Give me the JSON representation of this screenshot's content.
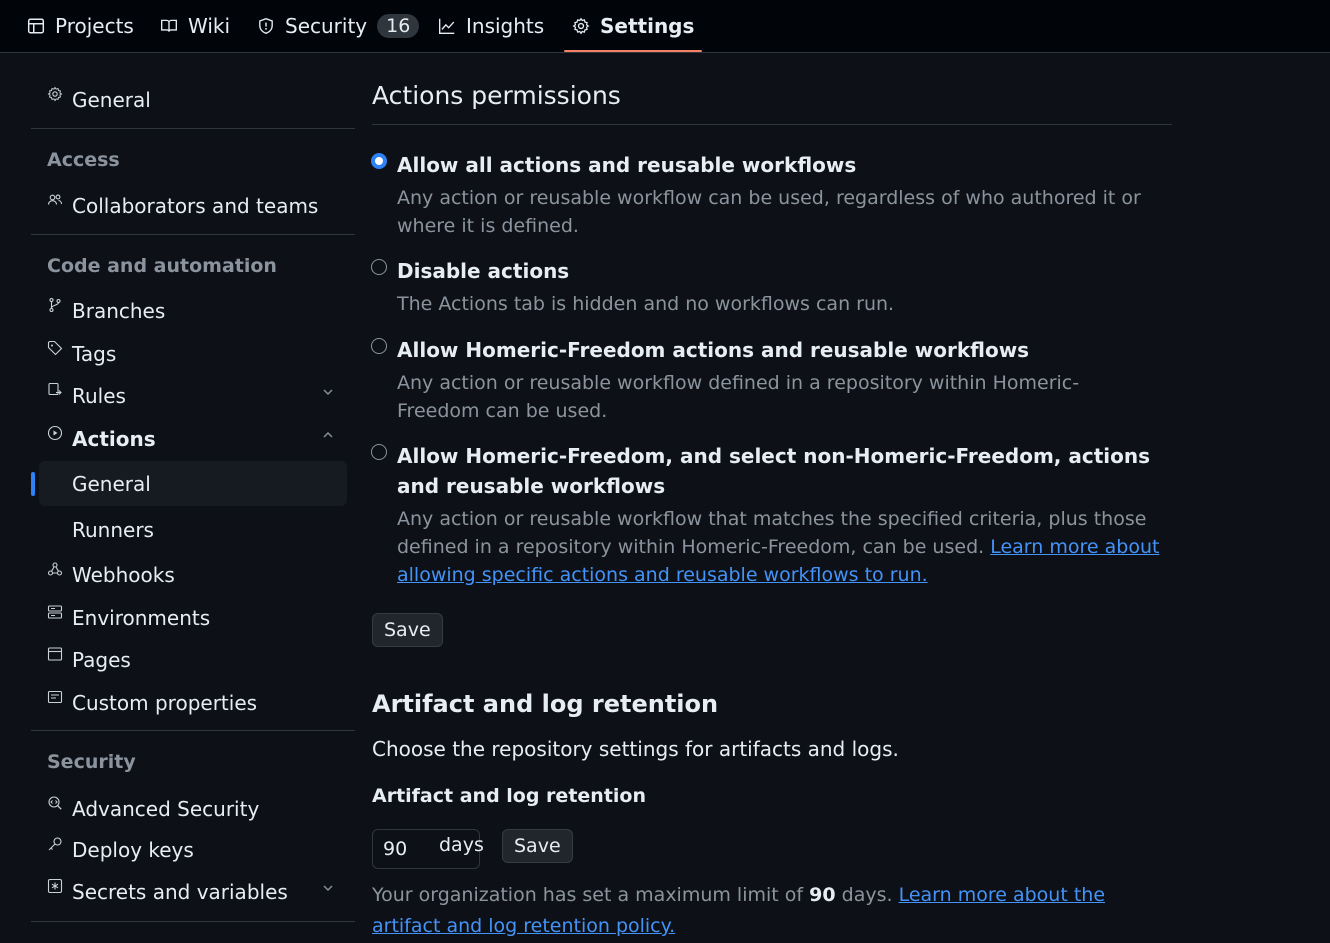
{
  "topnav": {
    "tabs": [
      {
        "label": "Projects",
        "icon": "table-icon"
      },
      {
        "label": "Wiki",
        "icon": "book-icon"
      },
      {
        "label": "Security",
        "icon": "shield-icon",
        "count": "16"
      },
      {
        "label": "Insights",
        "icon": "graph-icon"
      },
      {
        "label": "Settings",
        "icon": "gear-icon",
        "active": true
      }
    ]
  },
  "sidebar": {
    "general": "General",
    "access_heading": "Access",
    "collaborators": "Collaborators and teams",
    "code_heading": "Code and automation",
    "branches": "Branches",
    "tags": "Tags",
    "rules": "Rules",
    "actions": "Actions",
    "actions_general": "General",
    "actions_runners": "Runners",
    "webhooks": "Webhooks",
    "environments": "Environments",
    "pages": "Pages",
    "custom_properties": "Custom properties",
    "security_heading": "Security",
    "advanced_security": "Advanced Security",
    "deploy_keys": "Deploy keys",
    "secrets": "Secrets and variables"
  },
  "permissions": {
    "heading": "Actions permissions",
    "options": [
      {
        "title": "Allow all actions and reusable workflows",
        "desc": "Any action or reusable workflow can be used, regardless of who authored it or where it is defined.",
        "checked": true
      },
      {
        "title": "Disable actions",
        "desc": "The Actions tab is hidden and no workflows can run.",
        "checked": false
      },
      {
        "title": "Allow Homeric-Freedom actions and reusable workflows",
        "desc": "Any action or reusable workflow defined in a repository within Homeric-Freedom can be used.",
        "checked": false
      },
      {
        "title": "Allow Homeric-Freedom, and select non-Homeric-Freedom, actions and reusable workflows",
        "desc": "Any action or reusable workflow that matches the specified criteria, plus those defined in a repository within Homeric-Freedom, can be used.",
        "link": "Learn more about allowing specific actions and reusable workflows to run.",
        "checked": false
      }
    ],
    "save_label": "Save"
  },
  "retention": {
    "heading": "Artifact and log retention",
    "description": "Choose the repository settings for artifacts and logs.",
    "field_label": "Artifact and log retention",
    "days_value": "90",
    "days_suffix": "days",
    "save_label": "Save",
    "note_prefix": "Your organization has set a maximum limit of",
    "note_limit": "90",
    "note_suffix": "days.",
    "note_link": "Learn more about the artifact and log retention policy."
  },
  "colors": {
    "accent": "#2f81f7",
    "link": "#4493f8",
    "tab_underline": "#f78166",
    "background": "#0d1117"
  }
}
